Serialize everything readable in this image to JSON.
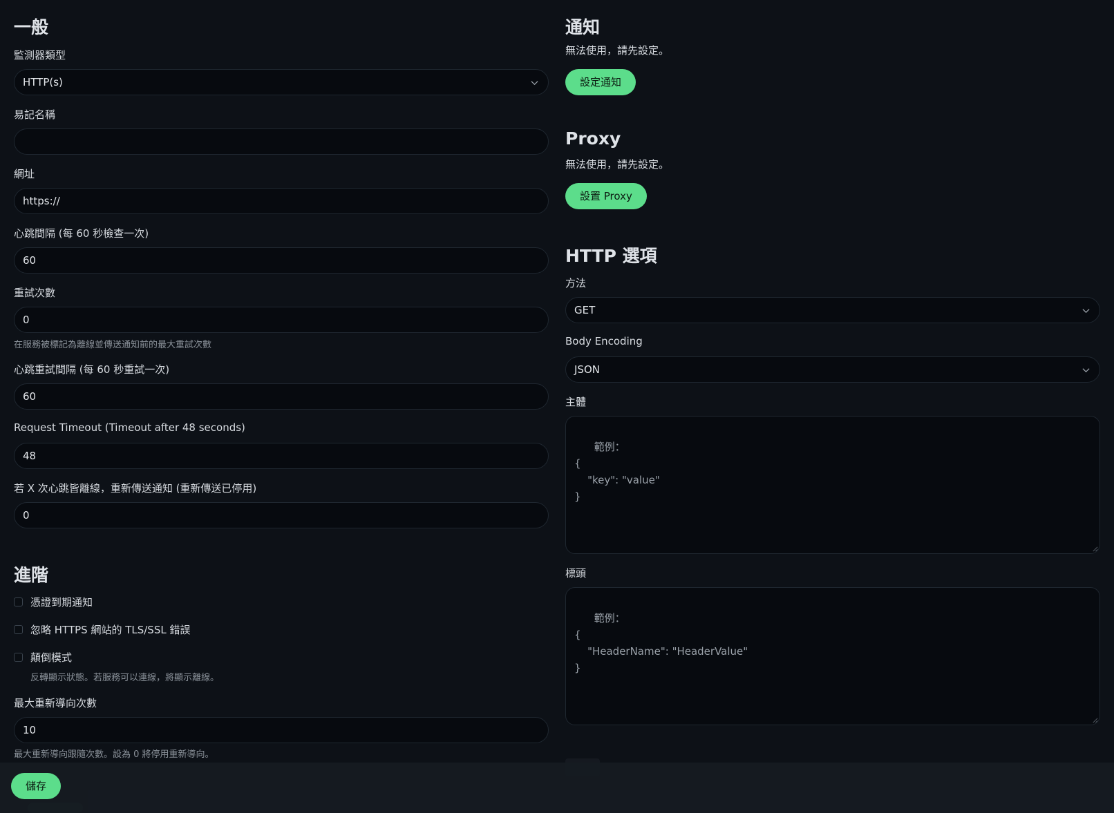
{
  "general": {
    "heading": "一般",
    "monitor_type": {
      "label": "監測器類型",
      "value": "HTTP(s)"
    },
    "friendly_name": {
      "label": "易記名稱",
      "value": ""
    },
    "url": {
      "label": "網址",
      "value": "https://"
    },
    "heartbeat_interval": {
      "label": "心跳間隔 (每 60 秒檢查一次)",
      "value": "60"
    },
    "retries": {
      "label": "重試次數",
      "value": "0",
      "help": "在服務被標記為離線並傳送通知前的最大重試次數"
    },
    "retry_interval": {
      "label": "心跳重試間隔 (每 60 秒重試一次)",
      "value": "60"
    },
    "request_timeout": {
      "label": "Request Timeout (Timeout after 48 seconds)",
      "value": "48"
    },
    "resend_interval": {
      "label": "若 X 次心跳皆離線，重新傳送通知 (重新傳送已停用)",
      "value": "0"
    }
  },
  "advanced": {
    "heading": "進階",
    "cert_expiry": {
      "label": "憑證到期通知",
      "checked": false
    },
    "ignore_tls": {
      "label": "忽略 HTTPS 網站的 TLS/SSL 錯誤",
      "checked": false
    },
    "upside_down": {
      "label": "顛倒模式",
      "checked": false,
      "help": "反轉顯示狀態。若服務可以連線，將顯示離線。"
    },
    "max_redirects": {
      "label": "最大重新導向次數",
      "value": "10",
      "help": "最大重新導向跟隨次數。設為 0 將停用重新導向。"
    }
  },
  "notifications": {
    "heading": "通知",
    "desc": "無法使用，請先設定。",
    "button": "設定通知"
  },
  "proxy": {
    "heading": "Proxy",
    "desc": "無法使用，請先設定。",
    "button": "設置 Proxy"
  },
  "http_options": {
    "heading": "HTTP 選項",
    "method": {
      "label": "方法",
      "value": "GET"
    },
    "body_encoding": {
      "label": "Body Encoding",
      "value": "JSON"
    },
    "body": {
      "label": "主體",
      "placeholder": "範例：\n{\n    \"key\": \"value\"\n}"
    },
    "headers": {
      "label": "標頭",
      "placeholder": "範例：\n{\n    \"HeaderName\": \"HeaderValue\"\n}"
    }
  },
  "footer": {
    "save": "儲存"
  },
  "colors": {
    "accent": "#5cdd8b",
    "background": "#0d1117",
    "input_bg": "#070a0f"
  }
}
